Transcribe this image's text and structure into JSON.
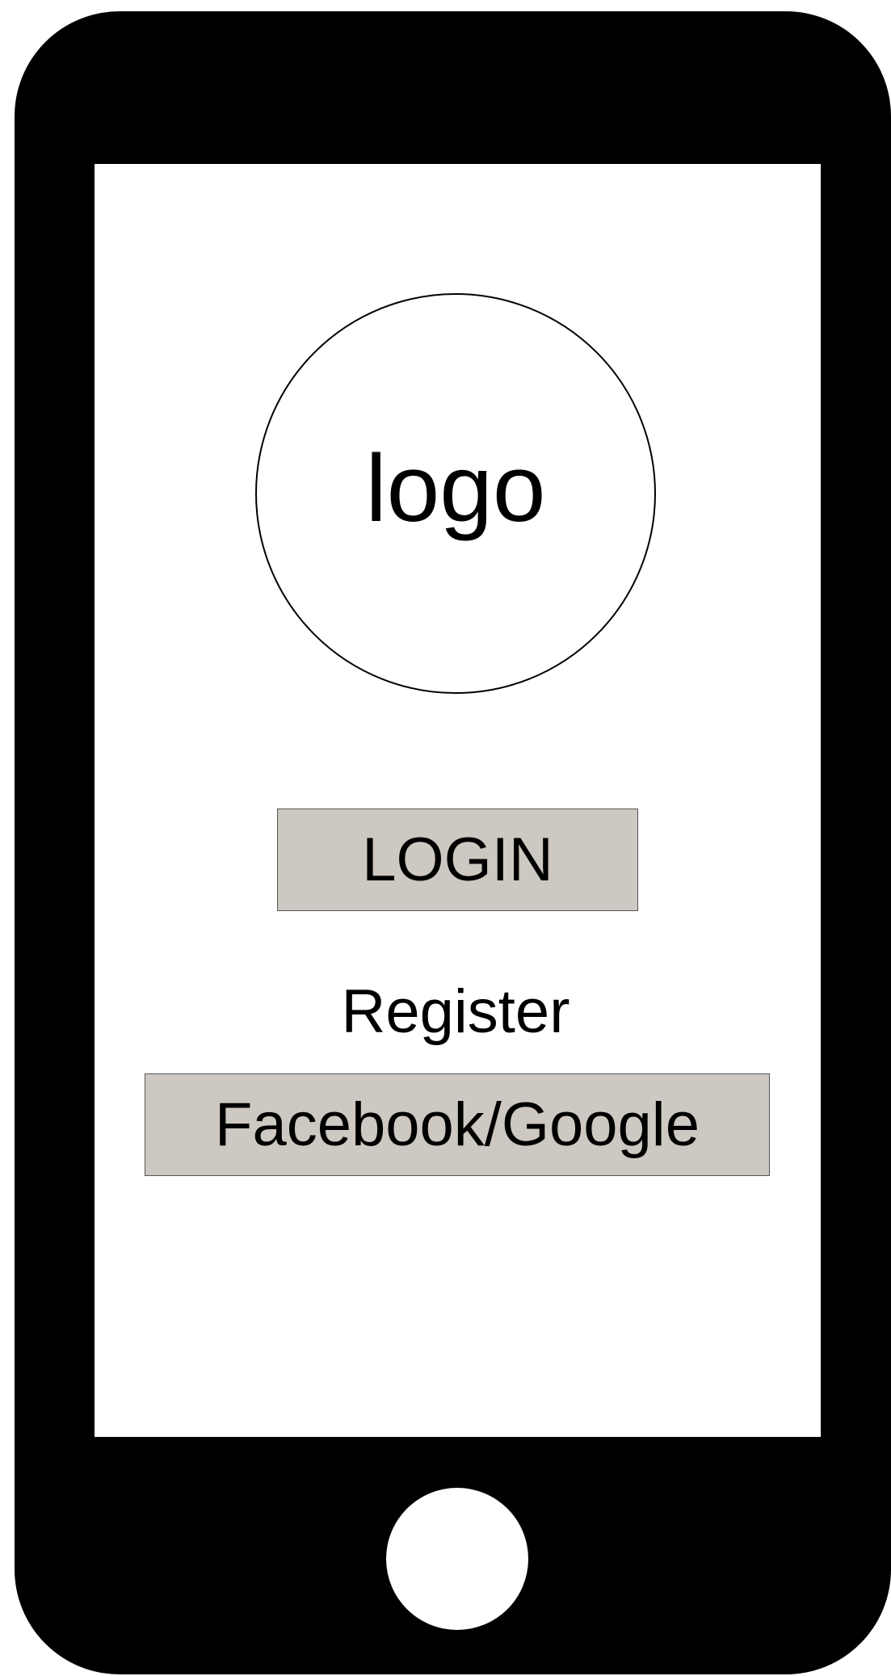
{
  "logo": {
    "text": "logo"
  },
  "login": {
    "label": "LOGIN"
  },
  "register": {
    "label": "Register"
  },
  "social_login": {
    "label": "Facebook/Google"
  },
  "colors": {
    "device": "#000000",
    "screen": "#ffffff",
    "button_fill": "#cdc8c1"
  }
}
